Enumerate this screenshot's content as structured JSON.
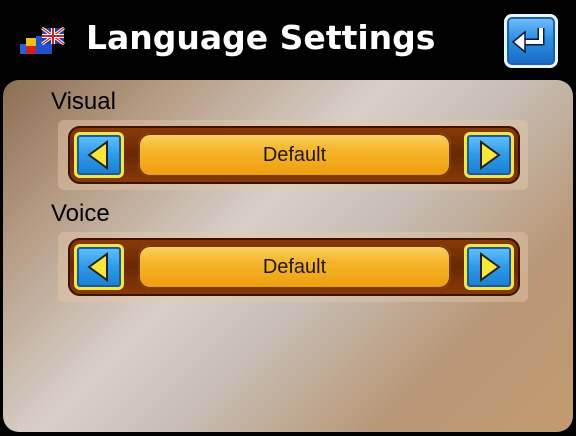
{
  "header": {
    "title": "Language Settings",
    "icon": "language-flag-icon",
    "back_icon": "return-arrow-icon"
  },
  "sections": [
    {
      "label": "Visual",
      "value": "Default",
      "prev_icon": "left-arrow-icon",
      "next_icon": "right-arrow-icon"
    },
    {
      "label": "Voice",
      "value": "Default",
      "prev_icon": "left-arrow-icon",
      "next_icon": "right-arrow-icon"
    }
  ],
  "colors": {
    "accent_blue": "#2d9ae8",
    "arrow_border_yellow": "#f2e640",
    "value_bar_orange": "#f5b52a",
    "frame_brown": "#6b2804"
  }
}
